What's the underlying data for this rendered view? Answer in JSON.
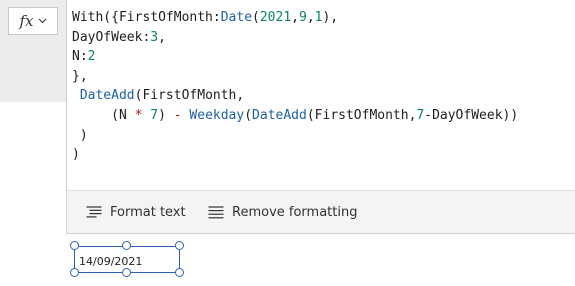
{
  "formula_bar": {
    "fx_label": "fx",
    "fx_dropdown_icon": "chevron-down-icon",
    "code_lines": [
      [
        "With({FirstOfMonth:",
        "Date",
        "(",
        "2021",
        ",",
        "9",
        ",",
        "1",
        "),"
      ],
      [
        "DayOfWeek:",
        "3",
        ","
      ],
      [
        "N:",
        "2"
      ],
      [
        "},"
      ],
      [
        " ",
        "DateAdd",
        "(FirstOfMonth,"
      ],
      [
        "     (N ",
        "*",
        " ",
        "7",
        ") ",
        "-",
        " ",
        "Weekday",
        "(",
        "DateAdd",
        "(FirstOfMonth,",
        "7",
        "-DayOfWeek))"
      ],
      [
        " )"
      ],
      [
        ")"
      ]
    ],
    "toolbar": {
      "format_text": {
        "label": "Format text",
        "icon": "format-text-icon"
      },
      "remove_formatting": {
        "label": "Remove formatting",
        "icon": "remove-formatting-icon"
      }
    }
  },
  "canvas": {
    "date_label": {
      "value": "14/09/2021"
    }
  },
  "colors": {
    "function": "#1f5fa8",
    "number": "#098658",
    "operator": "#a31515",
    "selection": "#2d62b2",
    "panel_gray": "#ececec",
    "toolbar_bg": "#f4f4f4"
  }
}
